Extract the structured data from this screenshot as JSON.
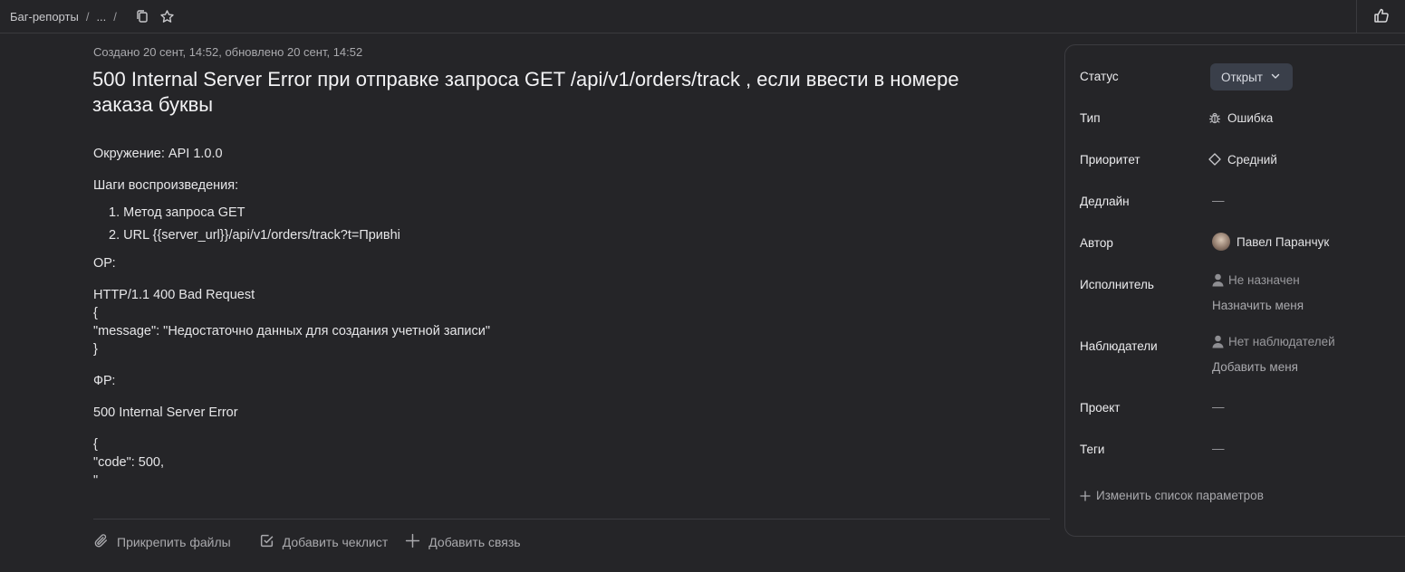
{
  "header": {
    "breadcrumb_root": "Баг-репорты",
    "breadcrumb_sep": "/",
    "breadcrumb_ellipsis": "...",
    "breadcrumb_sep2": "/",
    "copy_icon": "copy-icon",
    "star_icon": "star-icon",
    "like_icon": "thumbs-up-icon"
  },
  "issue": {
    "meta": "Создано 20 сент, 14:52, обновлено 20 сент, 14:52",
    "title": "500 Internal Server Error при отправке запроса GET /api/v1/orders/track , если ввести в номере заказа буквы",
    "environment": "Окружение: API 1.0.0",
    "steps_heading": "Шаги воспроизведения:",
    "steps": [
      "1. Метод запроса GET",
      "2. URL {{server_url}}/api/v1/orders/track?t=Привhi"
    ],
    "expected_heading": "ОР:",
    "expected_lines": [
      "HTTP/1.1 400 Bad Request",
      "{",
      "\"message\": \"Недостаточно данных для создания учетной записи\"",
      "}"
    ],
    "actual_heading": "ФР:",
    "actual_status": "500 Internal Server Error",
    "actual_lines": [
      "{",
      "\"code\": 500,",
      "\""
    ]
  },
  "actions": {
    "attach": "Прикрепить файлы",
    "checklist": "Добавить чеклист",
    "link": "Добавить связь"
  },
  "panel": {
    "status_label": "Статус",
    "status_value": "Открыт",
    "type_label": "Тип",
    "type_value": "Ошибка",
    "priority_label": "Приоритет",
    "priority_value": "Средний",
    "deadline_label": "Дедлайн",
    "deadline_value": "—",
    "author_label": "Автор",
    "author_value": "Павел Паранчук",
    "assignee_label": "Исполнитель",
    "assignee_value": "Не назначен",
    "assign_me": "Назначить меня",
    "watchers_label": "Наблюдатели",
    "watchers_value": "Нет наблюдателей",
    "watch_me": "Добавить меня",
    "project_label": "Проект",
    "project_value": "—",
    "tags_label": "Теги",
    "tags_value": "—",
    "edit_params": "Изменить список параметров"
  },
  "colors": {
    "background": "#252528",
    "status_button": "#3a3f4a",
    "muted_text": "#a9a9ad"
  }
}
